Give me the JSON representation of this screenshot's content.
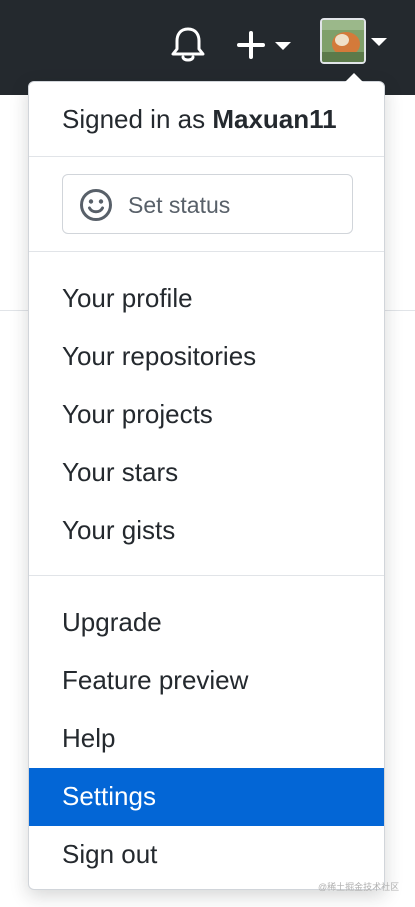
{
  "header": {
    "icons": [
      "bell-icon",
      "plus-icon",
      "caret-down-icon",
      "avatar"
    ]
  },
  "menu": {
    "signed_in_prefix": "Signed in as",
    "username": "Maxuan11",
    "status_label": "Set status",
    "section1": [
      "Your profile",
      "Your repositories",
      "Your projects",
      "Your stars",
      "Your gists"
    ],
    "section2": [
      "Upgrade",
      "Feature preview",
      "Help",
      "Settings",
      "Sign out"
    ],
    "active_item": "Settings",
    "accent_color": "#0366d6"
  },
  "watermark": "@稀土掘金技术社区"
}
